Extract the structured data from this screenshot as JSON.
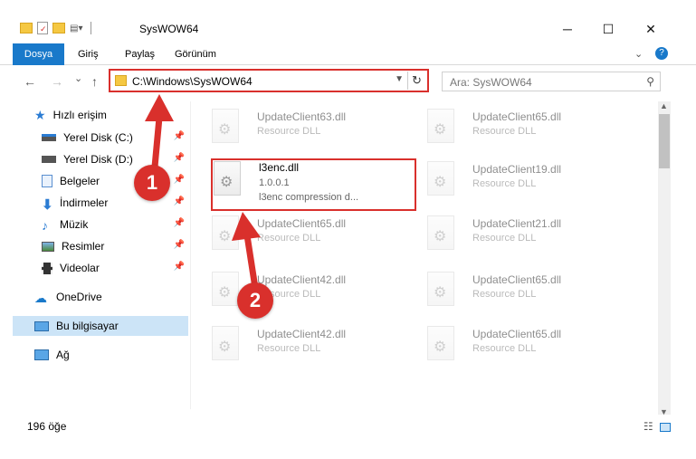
{
  "window": {
    "title": "SysWOW64",
    "minimize": "─",
    "maximize": "☐",
    "close": "✕"
  },
  "ribbon": {
    "tabs": [
      "Dosya",
      "Giriş",
      "Paylaş",
      "Görünüm"
    ],
    "expand_icon": "chevron-down-icon",
    "help_icon": "help-icon"
  },
  "nav": {
    "back": "←",
    "forward": "→",
    "recent": "⌄",
    "up": "↑",
    "address": "C:\\Windows\\SysWOW64",
    "search_placeholder": "Ara: SysWOW64"
  },
  "sidebar": {
    "items": [
      {
        "label": "Hızlı erişim",
        "icon": "star-icon",
        "pinned": false
      },
      {
        "label": "Yerel Disk (C:)",
        "icon": "drive-icon",
        "pinned": true
      },
      {
        "label": "Yerel Disk (D:)",
        "icon": "drive-icon",
        "pinned": true
      },
      {
        "label": "Belgeler",
        "icon": "document-icon",
        "pinned": true
      },
      {
        "label": "İndirmeler",
        "icon": "download-icon",
        "pinned": true
      },
      {
        "label": "Müzik",
        "icon": "music-icon",
        "pinned": true
      },
      {
        "label": "Resimler",
        "icon": "picture-icon",
        "pinned": true
      },
      {
        "label": "Videolar",
        "icon": "video-icon",
        "pinned": true
      },
      {
        "label": "OneDrive",
        "icon": "cloud-icon",
        "pinned": false
      },
      {
        "label": "Bu bilgisayar",
        "icon": "computer-icon",
        "pinned": false
      },
      {
        "label": "Ağ",
        "icon": "network-icon",
        "pinned": false
      }
    ]
  },
  "files": [
    {
      "name": "UpdateClient63.dll",
      "desc": "Resource DLL"
    },
    {
      "name": "UpdateClient65.dll",
      "desc": "Resource DLL"
    },
    {
      "name": "l3enc.dll",
      "version": "1.0.0.1",
      "desc": "l3enc compression d..."
    },
    {
      "name": "UpdateClient19.dll",
      "desc": "Resource DLL"
    },
    {
      "name": "UpdateClient65.dll",
      "desc": "Resource DLL"
    },
    {
      "name": "UpdateClient21.dll",
      "desc": "Resource DLL"
    },
    {
      "name": "UpdateClient42.dll",
      "desc": "Resource DLL"
    },
    {
      "name": "UpdateClient65.dll",
      "desc": "Resource DLL"
    },
    {
      "name": "UpdateClient42.dll",
      "desc": "Resource DLL"
    },
    {
      "name": "UpdateClient65.dll",
      "desc": "Resource DLL"
    }
  ],
  "status": {
    "count": "196 öğe"
  },
  "annotations": {
    "badge1": "1",
    "badge2": "2",
    "color": "#d9302c"
  }
}
